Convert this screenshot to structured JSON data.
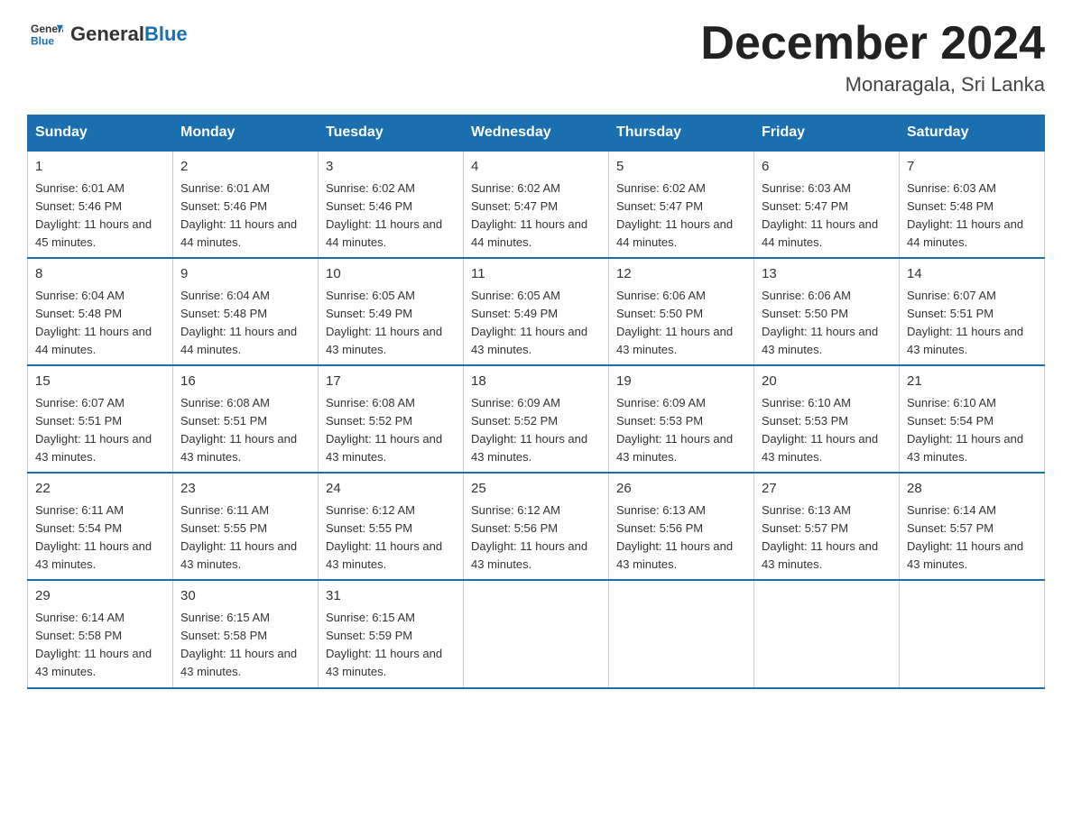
{
  "logo": {
    "text_general": "General",
    "text_blue": "Blue",
    "icon_alt": "GeneralBlue logo"
  },
  "header": {
    "title": "December 2024",
    "subtitle": "Monaragala, Sri Lanka"
  },
  "days_of_week": [
    "Sunday",
    "Monday",
    "Tuesday",
    "Wednesday",
    "Thursday",
    "Friday",
    "Saturday"
  ],
  "weeks": [
    [
      {
        "day": "1",
        "sunrise": "6:01 AM",
        "sunset": "5:46 PM",
        "daylight": "11 hours and 45 minutes."
      },
      {
        "day": "2",
        "sunrise": "6:01 AM",
        "sunset": "5:46 PM",
        "daylight": "11 hours and 44 minutes."
      },
      {
        "day": "3",
        "sunrise": "6:02 AM",
        "sunset": "5:46 PM",
        "daylight": "11 hours and 44 minutes."
      },
      {
        "day": "4",
        "sunrise": "6:02 AM",
        "sunset": "5:47 PM",
        "daylight": "11 hours and 44 minutes."
      },
      {
        "day": "5",
        "sunrise": "6:02 AM",
        "sunset": "5:47 PM",
        "daylight": "11 hours and 44 minutes."
      },
      {
        "day": "6",
        "sunrise": "6:03 AM",
        "sunset": "5:47 PM",
        "daylight": "11 hours and 44 minutes."
      },
      {
        "day": "7",
        "sunrise": "6:03 AM",
        "sunset": "5:48 PM",
        "daylight": "11 hours and 44 minutes."
      }
    ],
    [
      {
        "day": "8",
        "sunrise": "6:04 AM",
        "sunset": "5:48 PM",
        "daylight": "11 hours and 44 minutes."
      },
      {
        "day": "9",
        "sunrise": "6:04 AM",
        "sunset": "5:48 PM",
        "daylight": "11 hours and 44 minutes."
      },
      {
        "day": "10",
        "sunrise": "6:05 AM",
        "sunset": "5:49 PM",
        "daylight": "11 hours and 43 minutes."
      },
      {
        "day": "11",
        "sunrise": "6:05 AM",
        "sunset": "5:49 PM",
        "daylight": "11 hours and 43 minutes."
      },
      {
        "day": "12",
        "sunrise": "6:06 AM",
        "sunset": "5:50 PM",
        "daylight": "11 hours and 43 minutes."
      },
      {
        "day": "13",
        "sunrise": "6:06 AM",
        "sunset": "5:50 PM",
        "daylight": "11 hours and 43 minutes."
      },
      {
        "day": "14",
        "sunrise": "6:07 AM",
        "sunset": "5:51 PM",
        "daylight": "11 hours and 43 minutes."
      }
    ],
    [
      {
        "day": "15",
        "sunrise": "6:07 AM",
        "sunset": "5:51 PM",
        "daylight": "11 hours and 43 minutes."
      },
      {
        "day": "16",
        "sunrise": "6:08 AM",
        "sunset": "5:51 PM",
        "daylight": "11 hours and 43 minutes."
      },
      {
        "day": "17",
        "sunrise": "6:08 AM",
        "sunset": "5:52 PM",
        "daylight": "11 hours and 43 minutes."
      },
      {
        "day": "18",
        "sunrise": "6:09 AM",
        "sunset": "5:52 PM",
        "daylight": "11 hours and 43 minutes."
      },
      {
        "day": "19",
        "sunrise": "6:09 AM",
        "sunset": "5:53 PM",
        "daylight": "11 hours and 43 minutes."
      },
      {
        "day": "20",
        "sunrise": "6:10 AM",
        "sunset": "5:53 PM",
        "daylight": "11 hours and 43 minutes."
      },
      {
        "day": "21",
        "sunrise": "6:10 AM",
        "sunset": "5:54 PM",
        "daylight": "11 hours and 43 minutes."
      }
    ],
    [
      {
        "day": "22",
        "sunrise": "6:11 AM",
        "sunset": "5:54 PM",
        "daylight": "11 hours and 43 minutes."
      },
      {
        "day": "23",
        "sunrise": "6:11 AM",
        "sunset": "5:55 PM",
        "daylight": "11 hours and 43 minutes."
      },
      {
        "day": "24",
        "sunrise": "6:12 AM",
        "sunset": "5:55 PM",
        "daylight": "11 hours and 43 minutes."
      },
      {
        "day": "25",
        "sunrise": "6:12 AM",
        "sunset": "5:56 PM",
        "daylight": "11 hours and 43 minutes."
      },
      {
        "day": "26",
        "sunrise": "6:13 AM",
        "sunset": "5:56 PM",
        "daylight": "11 hours and 43 minutes."
      },
      {
        "day": "27",
        "sunrise": "6:13 AM",
        "sunset": "5:57 PM",
        "daylight": "11 hours and 43 minutes."
      },
      {
        "day": "28",
        "sunrise": "6:14 AM",
        "sunset": "5:57 PM",
        "daylight": "11 hours and 43 minutes."
      }
    ],
    [
      {
        "day": "29",
        "sunrise": "6:14 AM",
        "sunset": "5:58 PM",
        "daylight": "11 hours and 43 minutes."
      },
      {
        "day": "30",
        "sunrise": "6:15 AM",
        "sunset": "5:58 PM",
        "daylight": "11 hours and 43 minutes."
      },
      {
        "day": "31",
        "sunrise": "6:15 AM",
        "sunset": "5:59 PM",
        "daylight": "11 hours and 43 minutes."
      },
      null,
      null,
      null,
      null
    ]
  ]
}
